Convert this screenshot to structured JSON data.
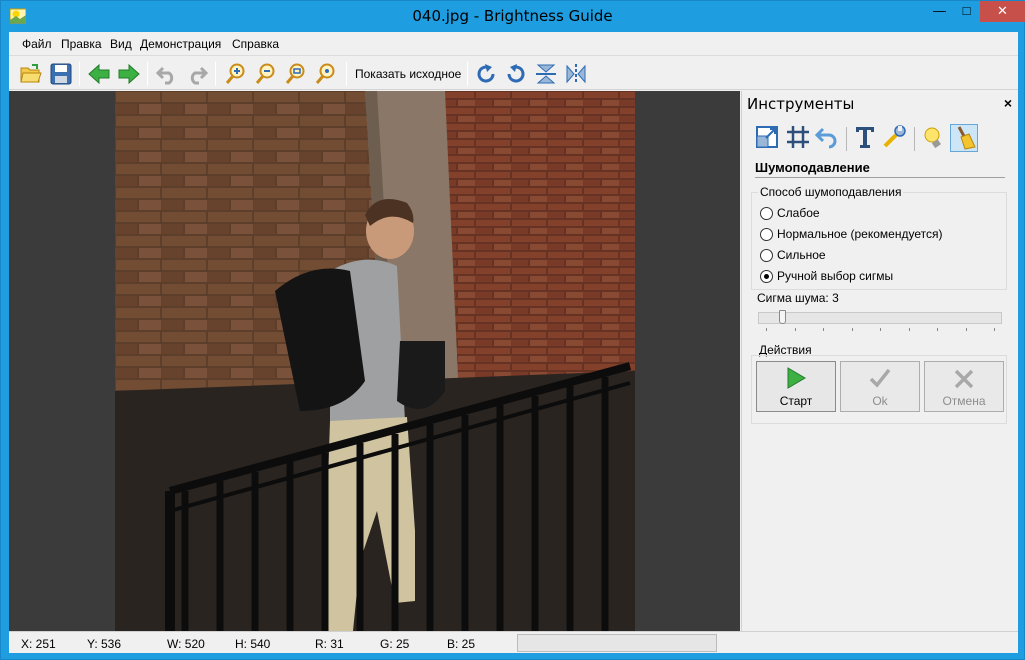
{
  "window": {
    "title": "040.jpg - Brightness Guide",
    "minimize_glyph": "—",
    "maximize_glyph": "□",
    "close_glyph": "✕"
  },
  "menu": [
    "Файл",
    "Правка",
    "Вид",
    "Демонстрация",
    "Справка"
  ],
  "toolbar": {
    "show_original_label": "Показать исходное",
    "buttons": [
      "open-icon",
      "save-icon",
      "back-icon",
      "forward-icon",
      "undo-icon",
      "redo-icon",
      "zoom-in-icon",
      "zoom-out-icon",
      "zoom-fit-icon",
      "zoom-actual-icon",
      "rotate-cw-icon",
      "rotate-ccw-icon",
      "flip-vertical-icon",
      "flip-horizontal-icon"
    ]
  },
  "panel": {
    "title": "Инструменты",
    "close_glyph": "×",
    "tools": [
      "resize-icon",
      "grid-icon",
      "undo-arrow-icon",
      "text-icon",
      "wrench-icon",
      "bulb-icon",
      "broom-icon"
    ],
    "active_tool": "broom-icon",
    "section_title": "Шумоподавление",
    "method_group": {
      "label": "Способ шумоподавления",
      "options": [
        {
          "label": "Слабое",
          "checked": false
        },
        {
          "label": "Нормальное (рекомендуется)",
          "checked": false
        },
        {
          "label": "Сильное",
          "checked": false
        },
        {
          "label": "Ручной выбор сигмы",
          "checked": true
        }
      ]
    },
    "sigma": {
      "label": "Сигма шума: 3",
      "value": 3,
      "min": 1,
      "max": 30,
      "ticks": 9
    },
    "actions_group": {
      "label": "Действия",
      "start": "Старт",
      "ok": "Ok",
      "cancel": "Отмена"
    }
  },
  "status": {
    "x": "X: 251",
    "y": "Y: 536",
    "w": "W: 520",
    "h": "H: 540",
    "r": "R: 31",
    "g": "G: 25",
    "b": "B: 25"
  }
}
